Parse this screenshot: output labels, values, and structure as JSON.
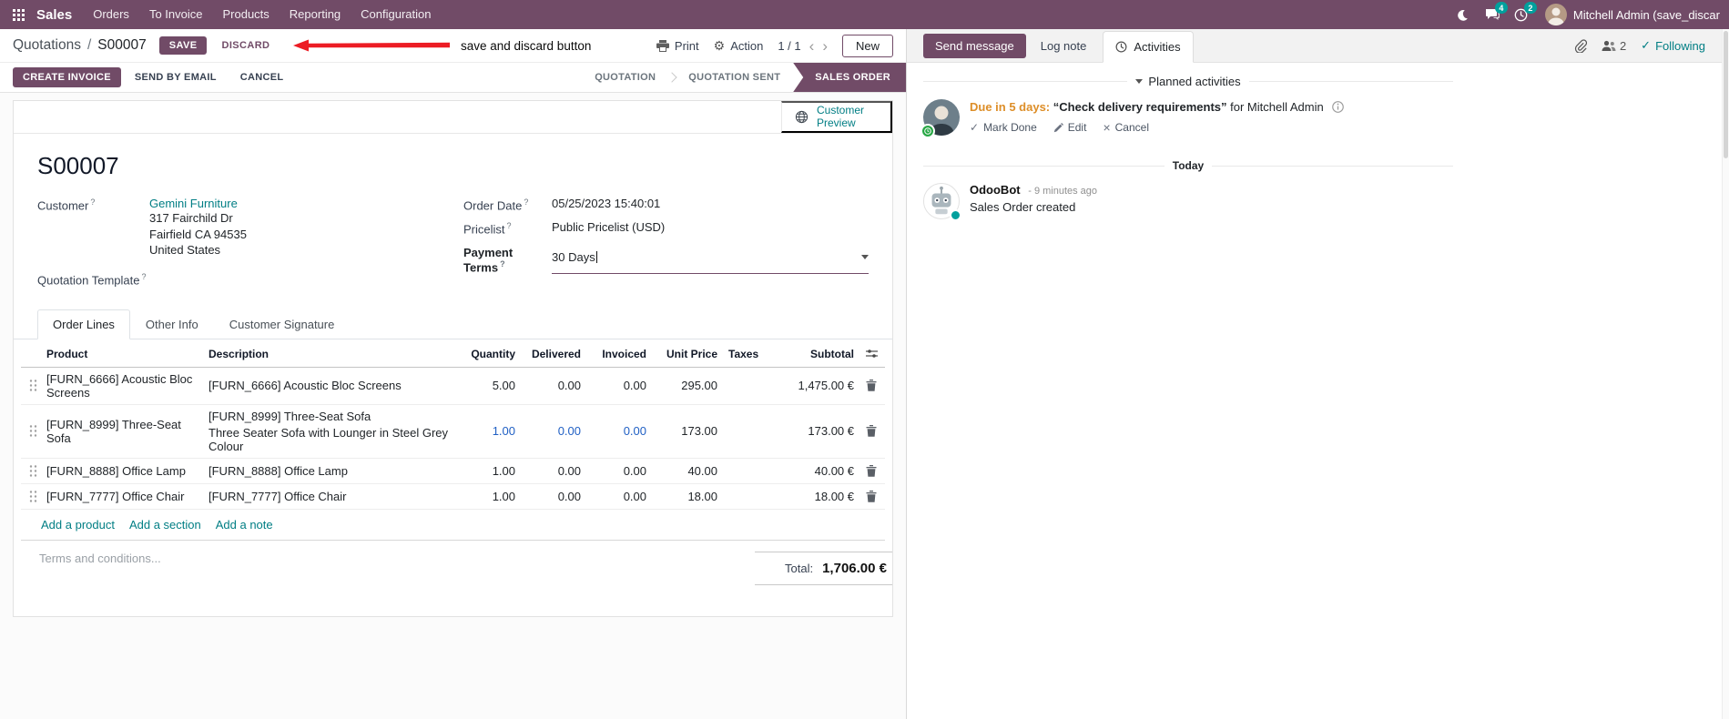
{
  "colors": {
    "primary": "#714B67",
    "link_teal": "#017E84",
    "modified_blue": "#2160C4",
    "activity_due_orange": "#DD8E28",
    "annotation_red": "#EC1C24",
    "badge_teal": "#00A09D"
  },
  "topbar": {
    "brand": "Sales",
    "menus": [
      "Orders",
      "To Invoice",
      "Products",
      "Reporting",
      "Configuration"
    ],
    "chat_badge": "4",
    "clock_badge": "2",
    "user_name": "Mitchell Admin (save_discar"
  },
  "control_panel": {
    "breadcrumb_parent": "Quotations",
    "breadcrumb_separator": "/",
    "breadcrumb_current": "S00007",
    "save_label": "SAVE",
    "discard_label": "DISCARD",
    "annotation_text": "save and discard button",
    "print_label": "Print",
    "action_label": "Action",
    "pager_value": "1 / 1",
    "pager_prev": "‹",
    "pager_next": "›",
    "new_label": "New"
  },
  "statusbar": {
    "create_invoice": "CREATE INVOICE",
    "send_by_email": "SEND BY EMAIL",
    "cancel": "CANCEL",
    "states": [
      "QUOTATION",
      "QUOTATION SENT",
      "SALES ORDER"
    ],
    "active_state": "SALES ORDER"
  },
  "sheet": {
    "stat_button_line1": "Customer",
    "stat_button_line2": "Preview",
    "title": "S00007",
    "help_marker": "?",
    "fields": {
      "customer_label": "Customer",
      "customer_name": "Gemini Furniture",
      "address_line1": "317 Fairchild Dr",
      "address_line2": "Fairfield CA 94535",
      "address_line3": "United States",
      "quotation_template_label": "Quotation Template",
      "order_date_label": "Order Date",
      "order_date_value": "05/25/2023 15:40:01",
      "pricelist_label": "Pricelist",
      "pricelist_value": "Public Pricelist (USD)",
      "payment_terms_label": "Payment Terms",
      "payment_terms_value": "30 Days"
    },
    "tabs": [
      "Order Lines",
      "Other Info",
      "Customer Signature"
    ],
    "order_lines": {
      "columns": [
        "Product",
        "Description",
        "Quantity",
        "Delivered",
        "Invoiced",
        "Unit Price",
        "Taxes",
        "Subtotal"
      ],
      "rows": [
        {
          "product": "[FURN_6666] Acoustic Bloc Screens",
          "description": "[FURN_6666] Acoustic Bloc Screens",
          "description2": "",
          "quantity": "5.00",
          "delivered": "0.00",
          "invoiced": "0.00",
          "unit_price": "295.00",
          "taxes": "",
          "subtotal": "1,475.00 €",
          "modified": false
        },
        {
          "product": "[FURN_8999] Three-Seat Sofa",
          "description": "[FURN_8999] Three-Seat Sofa",
          "description2": "Three Seater Sofa with Lounger in Steel Grey Colour",
          "quantity": "1.00",
          "delivered": "0.00",
          "invoiced": "0.00",
          "unit_price": "173.00",
          "taxes": "",
          "subtotal": "173.00 €",
          "modified": true
        },
        {
          "product": "[FURN_8888] Office Lamp",
          "description": "[FURN_8888] Office Lamp",
          "description2": "",
          "quantity": "1.00",
          "delivered": "0.00",
          "invoiced": "0.00",
          "unit_price": "40.00",
          "taxes": "",
          "subtotal": "40.00 €",
          "modified": false
        },
        {
          "product": "[FURN_7777] Office Chair",
          "description": "[FURN_7777] Office Chair",
          "description2": "",
          "quantity": "1.00",
          "delivered": "0.00",
          "invoiced": "0.00",
          "unit_price": "18.00",
          "taxes": "",
          "subtotal": "18.00 €",
          "modified": false
        }
      ],
      "add_product": "Add a product",
      "add_section": "Add a section",
      "add_note": "Add a note"
    },
    "terms_placeholder": "Terms and conditions...",
    "total_label": "Total:",
    "total_value": "1,706.00 €"
  },
  "chatter": {
    "send_message": "Send message",
    "log_note": "Log note",
    "activities": "Activities",
    "followers_count": "2",
    "following": "Following",
    "following_check": "✓",
    "planned_header": "Planned activities",
    "activity": {
      "due_text": "Due in 5 days:",
      "summary": "“Check delivery requirements”",
      "assigned": "for Mitchell Admin",
      "mark_done": "Mark Done",
      "mark_done_icon": "✓",
      "edit": "Edit",
      "cancel": "Cancel",
      "cancel_icon": "×"
    },
    "today_label": "Today",
    "message": {
      "author": "OdooBot",
      "timestamp": "- 9 minutes ago",
      "body": "Sales Order created"
    }
  }
}
